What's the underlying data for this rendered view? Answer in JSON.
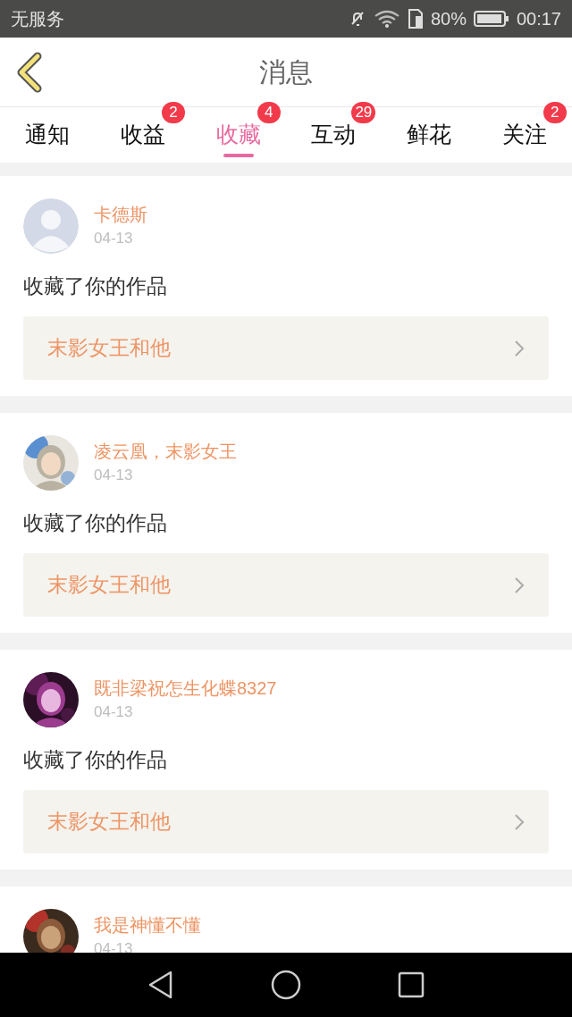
{
  "status_bar": {
    "carrier": "无服务",
    "battery": "80%",
    "time": "00:17"
  },
  "header": {
    "title": "消息"
  },
  "tabs": [
    {
      "label": "通知",
      "selected": false
    },
    {
      "label": "收益",
      "selected": false,
      "badge": "2"
    },
    {
      "label": "收藏",
      "selected": true,
      "badge": "4"
    },
    {
      "label": "互动",
      "selected": false,
      "badge": "29"
    },
    {
      "label": "鲜花",
      "selected": false
    },
    {
      "label": "关注",
      "selected": false,
      "badge": "2"
    }
  ],
  "messages": [
    {
      "avatar": {
        "kind": "default"
      },
      "name": "卡德斯",
      "date": "04-13",
      "text": "收藏了你的作品",
      "work": "末影女王和他"
    },
    {
      "name": "凌云凰，末影女王",
      "date": "04-13",
      "text": "收藏了你的作品",
      "work": "末影女王和他"
    },
    {
      "name": "既非梁祝怎生化蝶8327",
      "date": "04-13",
      "text": "收藏了你的作品",
      "work": "末影女王和他"
    },
    {
      "name": "我是神懂不懂",
      "date": "04-13"
    }
  ]
}
